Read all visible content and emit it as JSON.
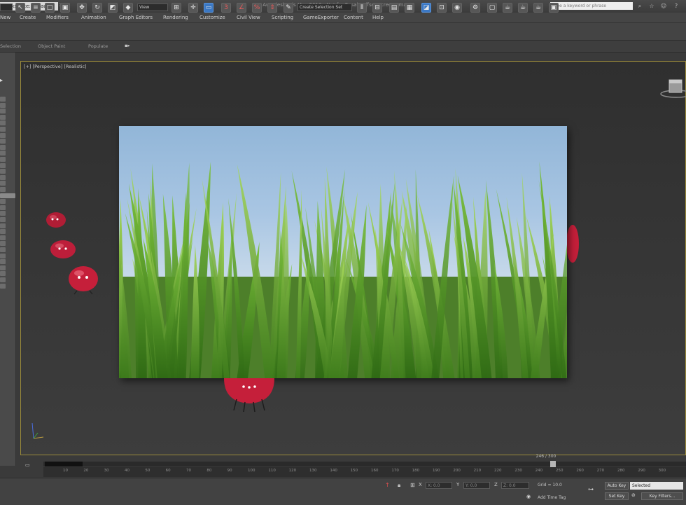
{
  "titlebar": {
    "workspace": "Workspace: Default",
    "workspace_close": "×",
    "title": "Autodesk 3ds Max 2016 - Not for Resale    offset-screens.max",
    "search_placeholder": "Type a keyword or phrase"
  },
  "menu": [
    "New",
    "Create",
    "Modifiers",
    "Animation",
    "Graph Editors",
    "Rendering",
    "Customize",
    "Civil View",
    "Scripting",
    "GameExporter",
    "Content",
    "Help"
  ],
  "toolbar": {
    "view_dropdown": "View",
    "selection_set": "Create Selection Set"
  },
  "ribbon": [
    "Selection",
    "Object Paint",
    "Populate"
  ],
  "viewport": {
    "label": "[+] [Perspective] [Realistic]"
  },
  "timeline": {
    "frame_counter": "246 / 300",
    "ticks": [
      "10",
      "20",
      "30",
      "40",
      "50",
      "60",
      "70",
      "80",
      "90",
      "100",
      "110",
      "120",
      "130",
      "140",
      "150",
      "160",
      "170",
      "180",
      "190",
      "200",
      "210",
      "220",
      "230",
      "240",
      "250",
      "260",
      "270",
      "280",
      "290",
      "300"
    ]
  },
  "statusbar": {
    "x_field": "X: 0.0",
    "y_field": "Y: 0.0",
    "z_field": "Z: 0.0",
    "grid": "Grid = 10.0",
    "add_time_tag": "Add Time Tag",
    "auto_key": "Auto Key",
    "set_key": "Set Key",
    "key_filters": "Key Filters...",
    "selected": "Selected"
  },
  "colors": {
    "viewport_border": "#9a8a3a",
    "active_tool": "#3b78c4",
    "bug_red": "#c51f3a",
    "grass_green": "#5a9a2a"
  }
}
